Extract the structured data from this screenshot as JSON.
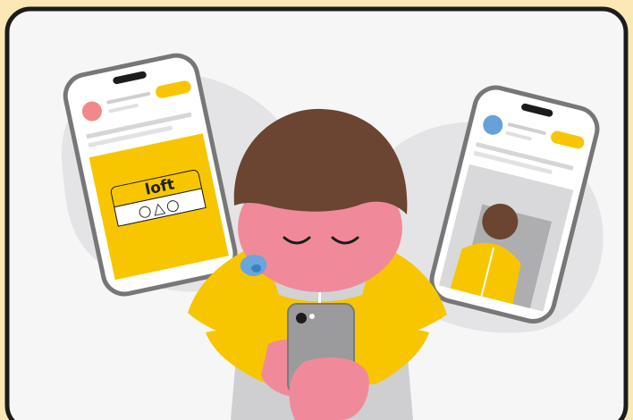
{
  "illustration": {
    "left_phone": {
      "card_logo": "loft",
      "card_symbols": "○△○"
    },
    "colors": {
      "background": "#fbe8b6",
      "panel": "#f6f6f6",
      "frame": "#1c1c1c",
      "accent_yellow": "#f7c600",
      "hair_brown": "#6b4432",
      "skin": "#f08a9a",
      "sweat_blue": "#67a7dd",
      "avatar_pink": "#f08a8a",
      "avatar_blue": "#6aa0d8",
      "blob_gray": "#e4e4e6"
    }
  }
}
